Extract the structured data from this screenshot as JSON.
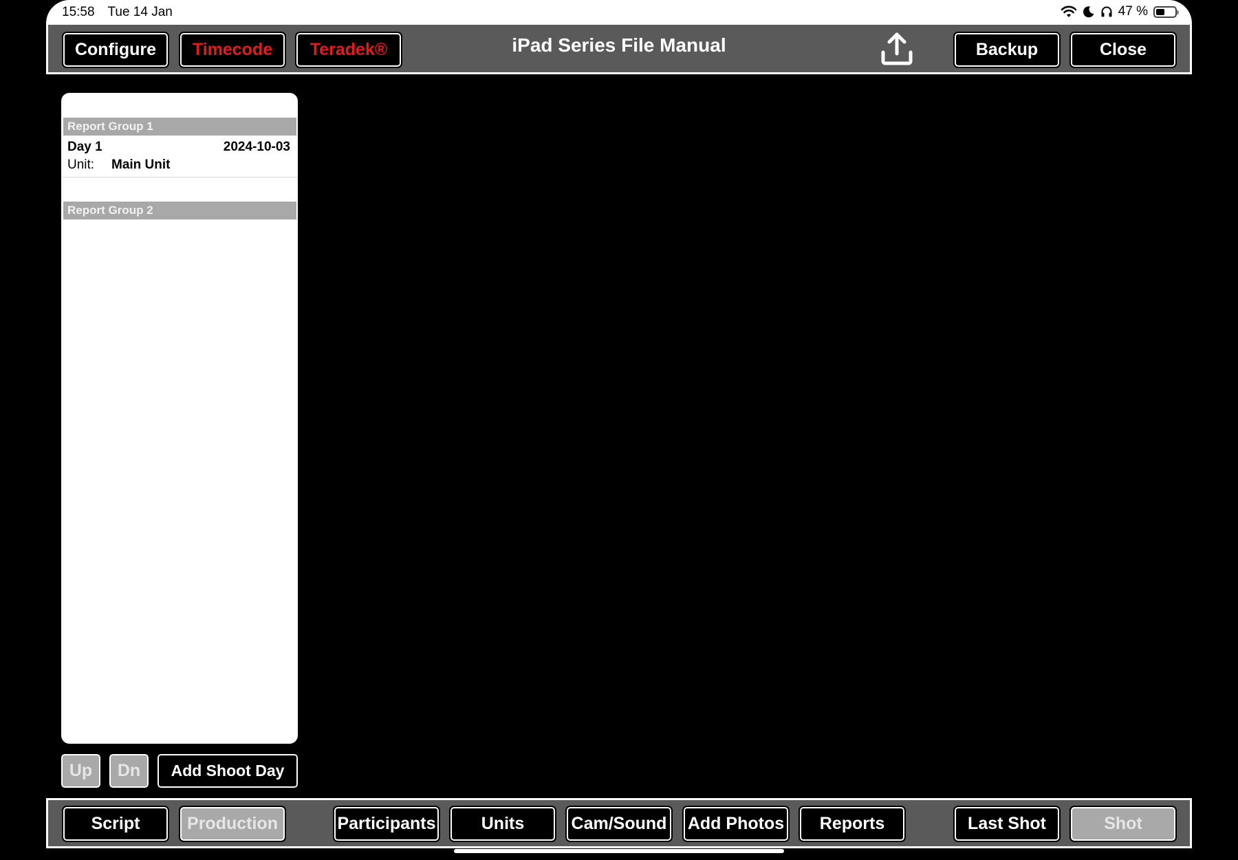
{
  "status_bar": {
    "time": "15:58",
    "date": "Tue 14 Jan",
    "battery_text": "47 %",
    "battery_level": 0.47,
    "icons": [
      "wifi-icon",
      "moon-icon",
      "headphones-icon",
      "battery-icon"
    ]
  },
  "top_toolbar": {
    "title": "iPad Series File Manual",
    "configure_label": "Configure",
    "timecode_label": "Timecode",
    "teradek_label": "Teradek®",
    "backup_label": "Backup",
    "close_label": "Close",
    "share_icon": "share-upload-icon"
  },
  "report_list": {
    "groups": [
      {
        "header": "Report Group 1",
        "days": [
          {
            "name": "Day 1",
            "date": "2024-10-03",
            "unit_label": "Unit:",
            "unit_value": "Main Unit"
          }
        ]
      },
      {
        "header": "Report Group 2",
        "days": []
      }
    ]
  },
  "list_controls": {
    "up_label": "Up",
    "dn_label": "Dn",
    "add_shoot_day_label": "Add Shoot Day"
  },
  "bottom_toolbar": {
    "script_label": "Script",
    "production_label": "Production",
    "participants_label": "Participants",
    "units_label": "Units",
    "cam_sound_label": "Cam/Sound",
    "add_photos_label": "Add Photos",
    "reports_label": "Reports",
    "last_shot_label": "Last Shot",
    "shot_label": "Shot"
  },
  "colors": {
    "toolbar_bg": "#5a5a5a",
    "button_bg": "#000000",
    "accent_red": "#e41b1b",
    "disabled_bg": "#a9a9a9",
    "group_header_bg": "#a8a8a8"
  }
}
